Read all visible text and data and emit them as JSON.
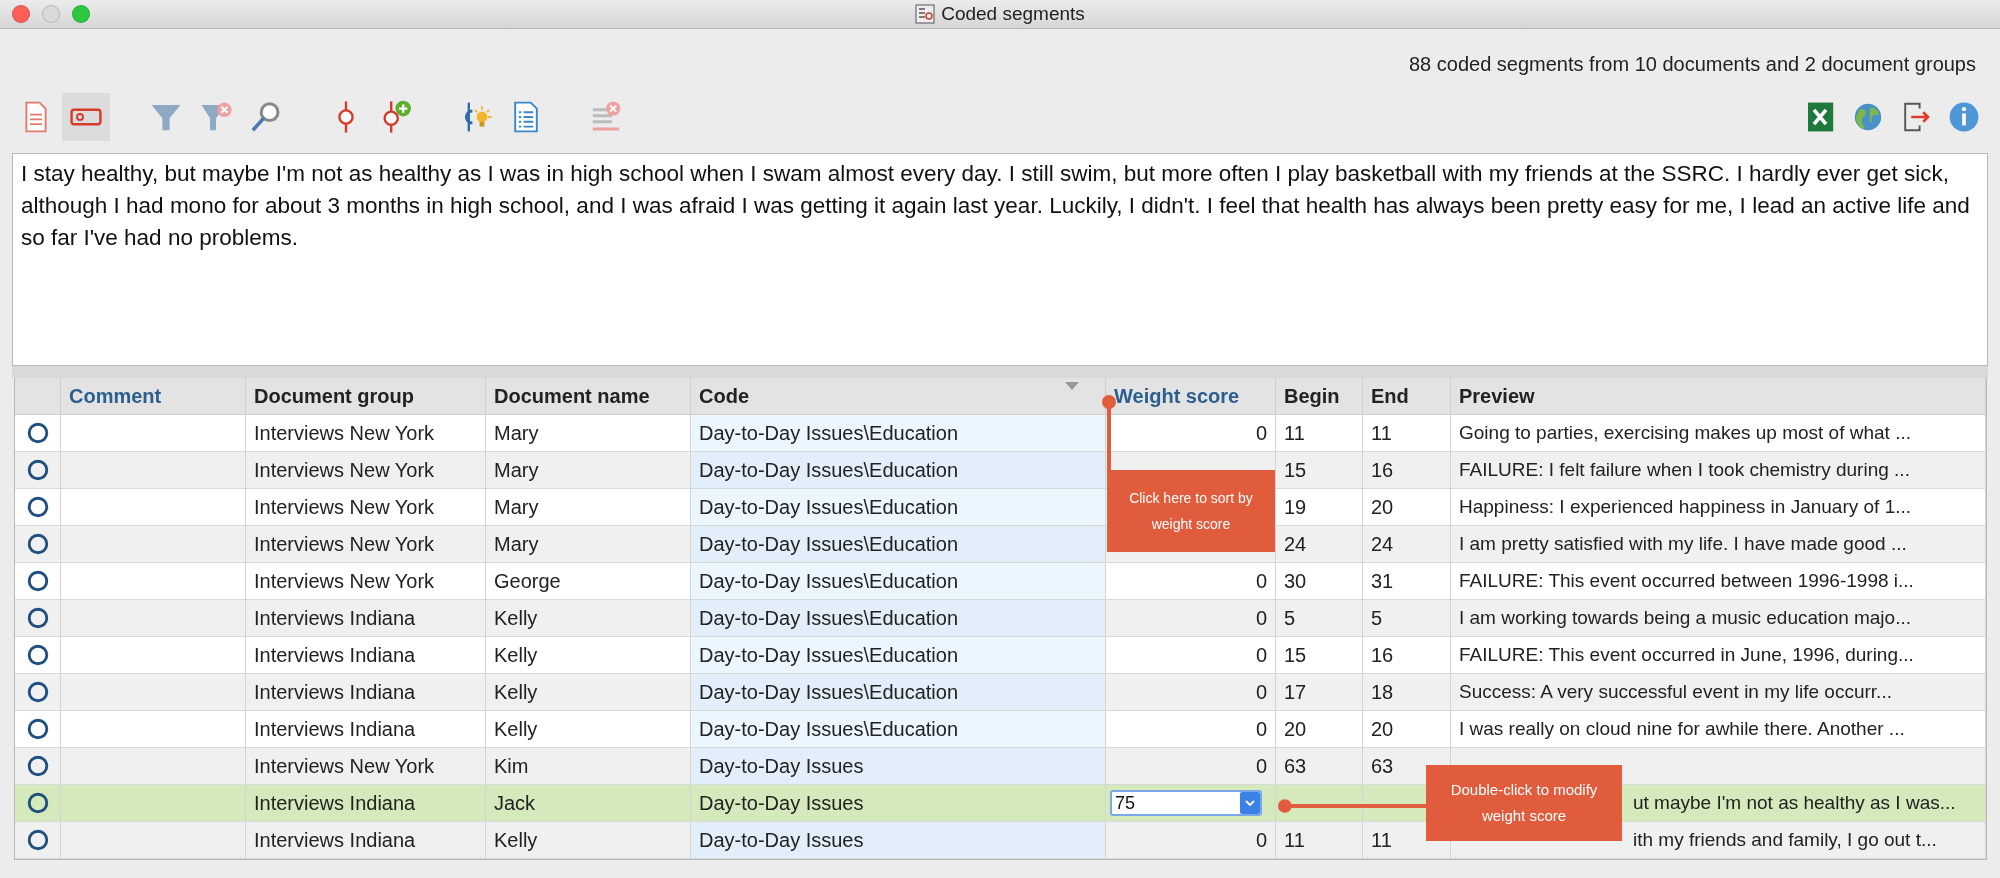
{
  "window": {
    "title": "Coded segments"
  },
  "summary": "88 coded segments from 10 documents and 2 document groups",
  "toolbar": {
    "groups": [
      [
        {
          "kind": "document",
          "selected": false
        },
        {
          "kind": "tag",
          "selected": true
        }
      ],
      [
        {
          "kind": "filter",
          "selected": false
        },
        {
          "kind": "filter-clear",
          "selected": false
        },
        {
          "kind": "search",
          "selected": false
        }
      ],
      [
        {
          "kind": "code",
          "selected": false
        },
        {
          "kind": "code-add",
          "selected": false
        }
      ],
      [
        {
          "kind": "code-idea",
          "selected": false
        },
        {
          "kind": "list",
          "selected": false
        }
      ],
      [
        {
          "kind": "lines-clear",
          "selected": false
        }
      ]
    ],
    "right": [
      {
        "kind": "excel"
      },
      {
        "kind": "globe"
      },
      {
        "kind": "export"
      },
      {
        "kind": "info"
      }
    ]
  },
  "segment_text": "I stay healthy, but maybe I'm not as healthy as I was in high school when I swam almost every day.  I still swim, but more often I play basketball with my friends at the SSRC.  I hardly ever get sick, although I had mono for about 3 months in high school, and I was afraid I was getting it again last year.  Luckily, I didn't.  I feel that health has always been pretty easy for me, I lead an active life and so far I've had no problems.",
  "table": {
    "columns": [
      {
        "label": "Comment",
        "kind": "editable",
        "sorted": false
      },
      {
        "label": "Document group",
        "kind": "plain",
        "sorted": false
      },
      {
        "label": "Document name",
        "kind": "plain",
        "sorted": false
      },
      {
        "label": "Code",
        "kind": "plain",
        "sorted": true
      },
      {
        "label": "Weight score",
        "kind": "editable",
        "sorted": false
      },
      {
        "label": "Begin",
        "kind": "plain",
        "sorted": false
      },
      {
        "label": "End",
        "kind": "plain",
        "sorted": false
      },
      {
        "label": "Preview",
        "kind": "plain",
        "sorted": false
      }
    ],
    "rows": [
      {
        "selected": false,
        "document_group": "Interviews New York",
        "document_name": "Mary",
        "code": "Day-to-Day Issues\\Education",
        "weight_score": "0",
        "begin": "11",
        "end": "11",
        "preview": "Going to parties, exercising makes up most of what ..."
      },
      {
        "selected": false,
        "document_group": "Interviews New York",
        "document_name": "Mary",
        "code": "Day-to-Day Issues\\Education",
        "begin": "15",
        "end": "16",
        "preview": "FAILURE: I felt failure when I took chemistry during ..."
      },
      {
        "selected": false,
        "document_group": "Interviews New York",
        "document_name": "Mary",
        "code": "Day-to-Day Issues\\Education",
        "begin": "19",
        "end": "20",
        "preview": "Happiness: I experienced happiness in January of 1..."
      },
      {
        "selected": false,
        "document_group": "Interviews New York",
        "document_name": "Mary",
        "code": "Day-to-Day Issues\\Education",
        "begin": "24",
        "end": "24",
        "preview": "I am pretty satisfied with my life. I have made good ..."
      },
      {
        "selected": false,
        "document_group": "Interviews New York",
        "document_name": "George",
        "code": "Day-to-Day Issues\\Education",
        "weight_score": "0",
        "begin": "30",
        "end": "31",
        "preview": "FAILURE: This event occurred between 1996-1998 i..."
      },
      {
        "selected": false,
        "document_group": "Interviews Indiana",
        "document_name": "Kelly",
        "code": "Day-to-Day Issues\\Education",
        "weight_score": "0",
        "begin": "5",
        "end": "5",
        "preview": "I am working towards being a music education majo..."
      },
      {
        "selected": false,
        "document_group": "Interviews Indiana",
        "document_name": "Kelly",
        "code": "Day-to-Day Issues\\Education",
        "weight_score": "0",
        "begin": "15",
        "end": "16",
        "preview": "FAILURE: This event occurred in June, 1996, during..."
      },
      {
        "selected": false,
        "document_group": "Interviews Indiana",
        "document_name": "Kelly",
        "code": "Day-to-Day Issues\\Education",
        "weight_score": "0",
        "begin": "17",
        "end": "18",
        "preview": "Success:   A very successful event in my life occurr..."
      },
      {
        "selected": false,
        "document_group": "Interviews Indiana",
        "document_name": "Kelly",
        "code": "Day-to-Day Issues\\Education",
        "weight_score": "0",
        "begin": "20",
        "end": "20",
        "preview": "I was really on cloud nine for awhile there.  Another ..."
      },
      {
        "selected": false,
        "document_group": "Interviews New York",
        "document_name": "Kim",
        "code": "Day-to-Day Issues",
        "weight_score": "0",
        "begin": "63",
        "end": "63"
      },
      {
        "selected": true,
        "document_group": "Interviews Indiana",
        "document_name": "Jack",
        "code": "Day-to-Day Issues",
        "weight_editor": {
          "value": "75"
        },
        "preview": "ut maybe I'm not as healthy as I was...",
        "preview_partly_hidden": true
      },
      {
        "selected": false,
        "document_group": "Interviews Indiana",
        "document_name": "Kelly",
        "code": "Day-to-Day Issues",
        "weight_score": "0",
        "begin": "11",
        "end": "11",
        "preview": "ith my friends and family, I go out t...",
        "preview_partly_hidden": true
      }
    ]
  },
  "annotations": [
    {
      "text": "Click here to sort by weight score"
    },
    {
      "text": "Double-click to modify weight score"
    }
  ]
}
